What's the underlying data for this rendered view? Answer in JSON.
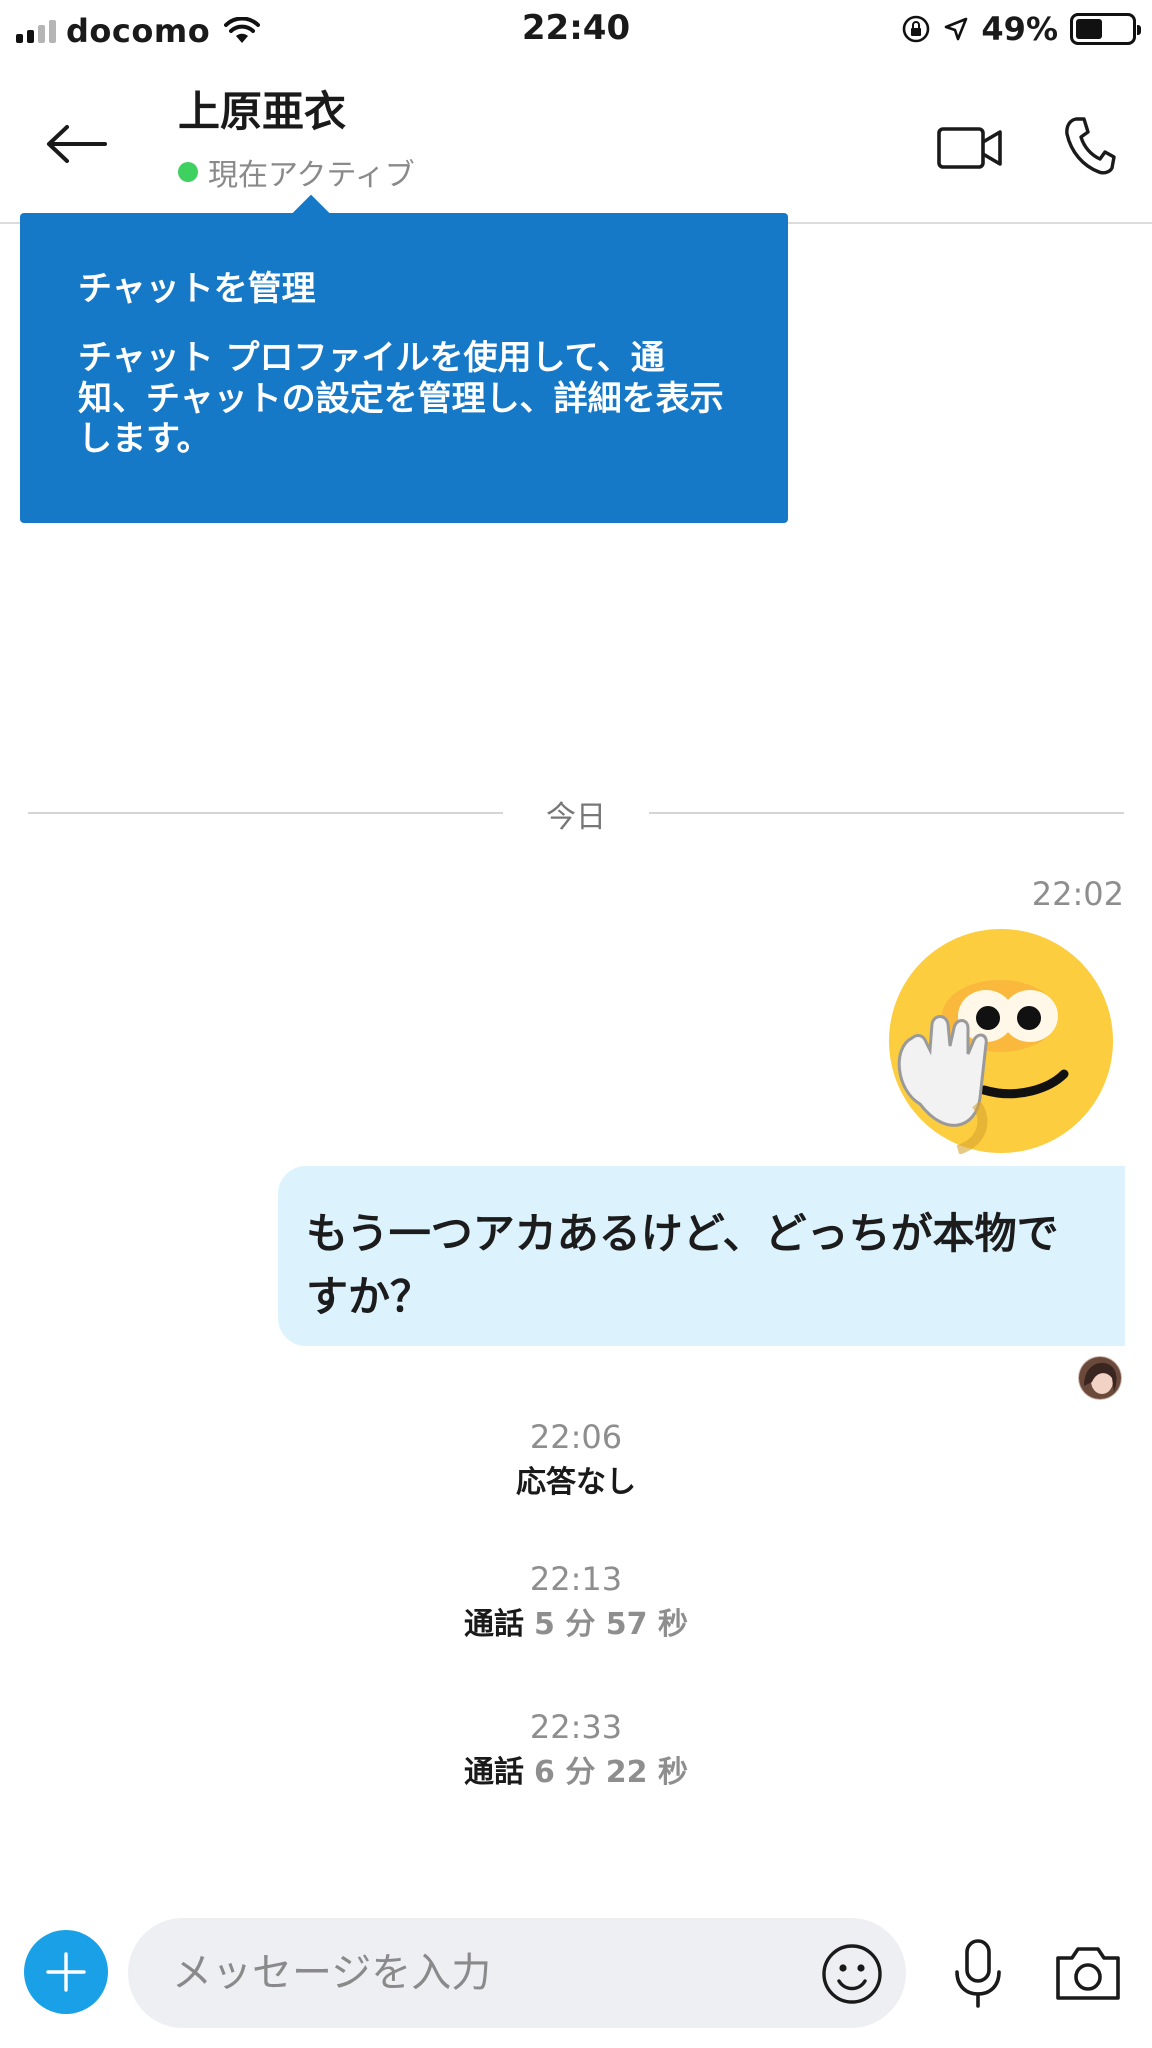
{
  "status_bar": {
    "carrier": "docomo",
    "time": "22:40",
    "battery_percent": "49%",
    "battery_level": 0.49,
    "icons": [
      "signal-icon",
      "wifi-icon",
      "rotation-lock-icon",
      "location-arrow-icon",
      "battery-icon"
    ]
  },
  "header": {
    "contact_name": "上原亜衣",
    "presence": "現在アクティブ",
    "presence_color": "#3ed160",
    "icons": [
      "back-arrow-icon",
      "video-call-icon",
      "phone-icon"
    ]
  },
  "tooltip": {
    "title": "チャットを管理",
    "body": "チャット プロファイルを使用して、通知、チャットの設定を管理し、詳細を表示します。",
    "background": "#1679c8"
  },
  "conversation": {
    "date_label": "今日",
    "message_time": "22:02",
    "emoji_icon": "hand-over-mouth-emoji",
    "message_text": "もう一つアカあるけど、どっちが本物ですか？",
    "bubble_color": "#dcf3fd",
    "read_receipt_icon": "avatar-read-receipt"
  },
  "call_log": [
    {
      "time": "22:06",
      "label": "応答なし",
      "duration": ""
    },
    {
      "time": "22:13",
      "label": "通話",
      "duration": "5 分 57 秒"
    },
    {
      "time": "22:33",
      "label": "通話",
      "duration": "6 分 22 秒"
    }
  ],
  "composer": {
    "placeholder": "メッセージを入力",
    "value": "",
    "accent": "#1aa0e6",
    "icons": [
      "plus-icon",
      "smiley-icon",
      "microphone-icon",
      "camera-icon"
    ]
  }
}
